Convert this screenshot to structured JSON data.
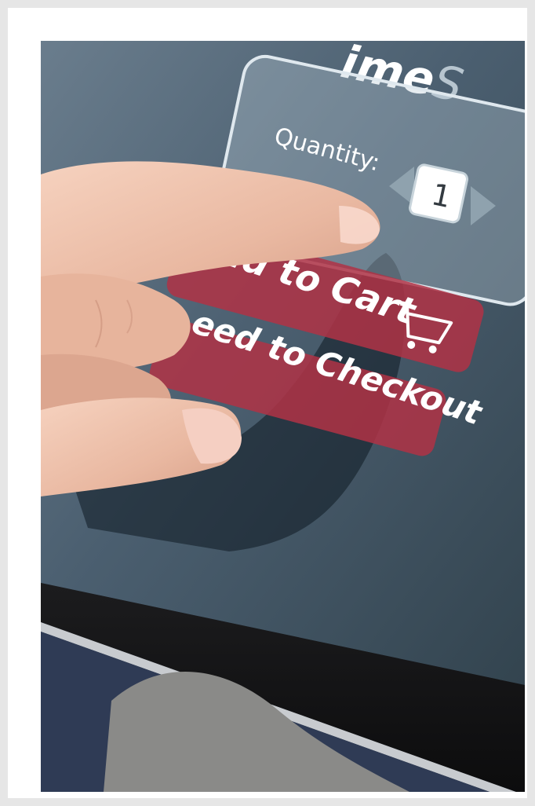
{
  "shop": {
    "brand_fragment_dark": "ime",
    "brand_fragment_light": "S"
  },
  "quantity": {
    "label": "Quantity:",
    "value": "1"
  },
  "buttons": {
    "add_to_cart": "Add to Cart",
    "checkout": "eed to Checkout"
  },
  "colors": {
    "button_red": "#b03345",
    "screen_blue": "#4a5d6f",
    "frame_bg": "#e6e6e6"
  },
  "icons": {
    "cart": "shopping-cart-icon",
    "left_arrow": "triangle-left-icon",
    "right_arrow": "triangle-right-icon"
  }
}
